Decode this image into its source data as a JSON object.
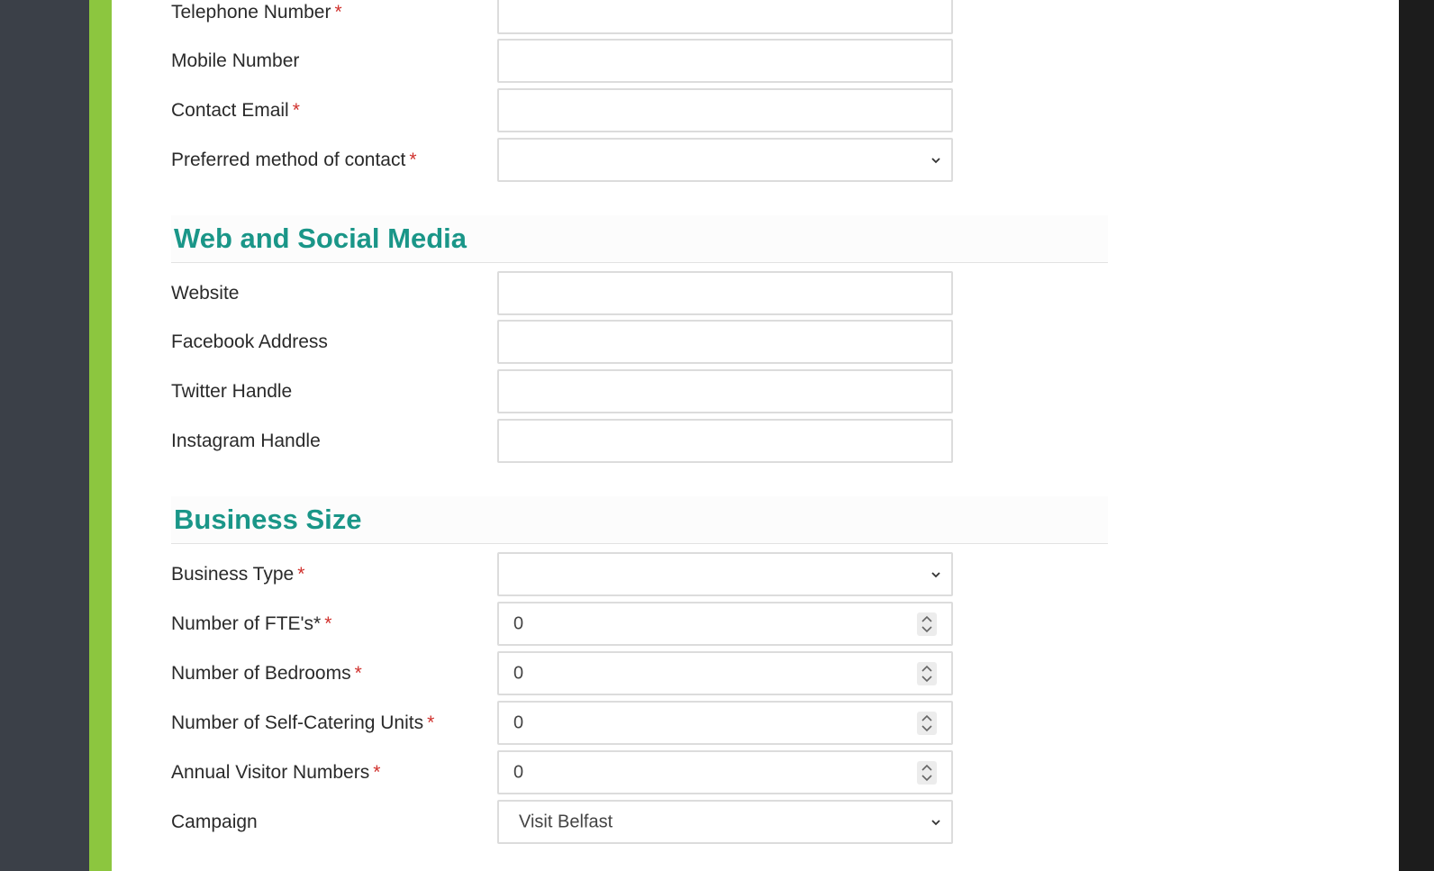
{
  "colors": {
    "accent_green": "#8cc63f",
    "heading_teal": "#1a9688",
    "required_red": "#d0312d",
    "left_gutter": "#3b4048"
  },
  "contact": {
    "telephone_label": "Telephone Number",
    "mobile_label": "Mobile Number",
    "email_label": "Contact Email",
    "preferred_label": "Preferred method of contact",
    "preferred_value": ""
  },
  "web_section": {
    "title": "Web and Social Media",
    "website_label": "Website",
    "facebook_label": "Facebook Address",
    "twitter_label": "Twitter Handle",
    "instagram_label": "Instagram Handle"
  },
  "business_section": {
    "title": "Business Size",
    "type_label": "Business Type",
    "type_value": "",
    "fte_label": "Number of FTE's*",
    "fte_value": "0",
    "bedrooms_label": "Number of Bedrooms",
    "bedrooms_value": "0",
    "selfcat_label": "Number of Self-Catering Units",
    "selfcat_value": "0",
    "visitors_label": "Annual Visitor Numbers",
    "visitors_value": "0",
    "campaign_label": "Campaign",
    "campaign_value": "Visit Belfast"
  },
  "required_marker": "*",
  "icons": {
    "chevron": "chevron-down-icon",
    "spinner": "stepper-icon"
  }
}
